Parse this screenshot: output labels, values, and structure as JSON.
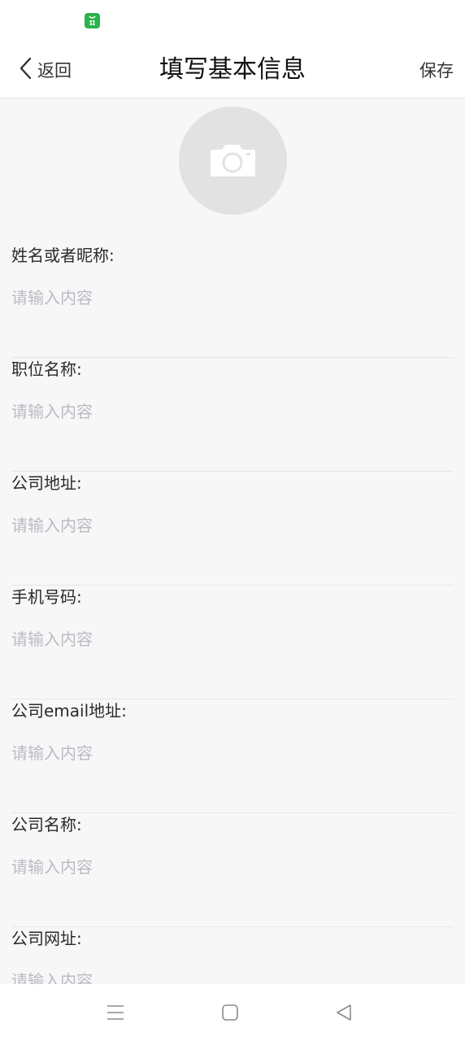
{
  "header": {
    "back_label": "返回",
    "title": "填写基本信息",
    "save_label": "保存"
  },
  "avatar": {
    "icon": "camera-icon"
  },
  "fields": [
    {
      "label": "姓名或者昵称:",
      "placeholder": "请输入内容"
    },
    {
      "label": "职位名称:",
      "placeholder": "请输入内容"
    },
    {
      "label": "公司地址:",
      "placeholder": "请输入内容"
    },
    {
      "label": "手机号码:",
      "placeholder": "请输入内容"
    },
    {
      "label": "公司email地址:",
      "placeholder": "请输入内容"
    },
    {
      "label": "公司名称:",
      "placeholder": "请输入内容"
    },
    {
      "label": "公司网址:",
      "placeholder": "请输入内容"
    }
  ],
  "system_nav": {
    "icons": [
      "menu-icon",
      "home-icon",
      "back-triangle-icon"
    ]
  },
  "colors": {
    "background": "#f7f7f7",
    "placeholder": "#b9bcc4",
    "status_app_icon": "#2bb24c"
  }
}
